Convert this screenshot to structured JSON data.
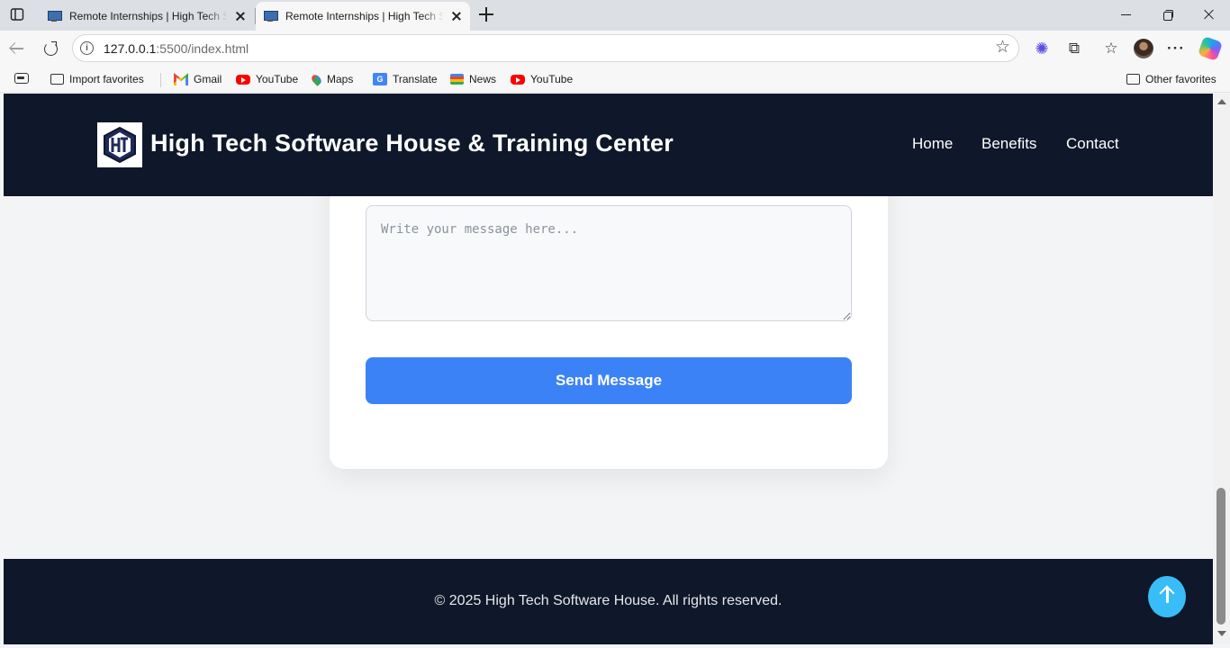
{
  "browser": {
    "tabs": [
      {
        "title": "Remote Internships | High Tech Software House & Training Center",
        "active": false
      },
      {
        "title": "Remote Internships | High Tech Software House & Training Center",
        "active": true
      }
    ],
    "address": {
      "host": "127.0.0.1",
      "path": ":5500/index.html"
    },
    "favorites": [
      {
        "label": "Import favorites",
        "icon": "import-icon"
      },
      {
        "label": "Gmail",
        "icon": "gmail-icon"
      },
      {
        "label": "YouTube",
        "icon": "youtube-icon"
      },
      {
        "label": "Maps",
        "icon": "maps-icon"
      },
      {
        "label": "Translate",
        "icon": "translate-icon"
      },
      {
        "label": "News",
        "icon": "news-icon"
      },
      {
        "label": "YouTube",
        "icon": "youtube-icon"
      }
    ],
    "other_favorites": "Other favorites"
  },
  "site": {
    "brand": "High Tech Software House & Training Center",
    "nav": [
      "Home",
      "Benefits",
      "Contact"
    ],
    "form": {
      "message_placeholder": "Write your message here...",
      "submit_label": "Send Message"
    },
    "footer_text": "© 2025 High Tech Software House. All rights reserved."
  },
  "colors": {
    "header_bg": "#0f172a",
    "accent": "#3b82f6",
    "back_to_top": "#38bdf8",
    "page_bg": "#f3f4f6"
  }
}
